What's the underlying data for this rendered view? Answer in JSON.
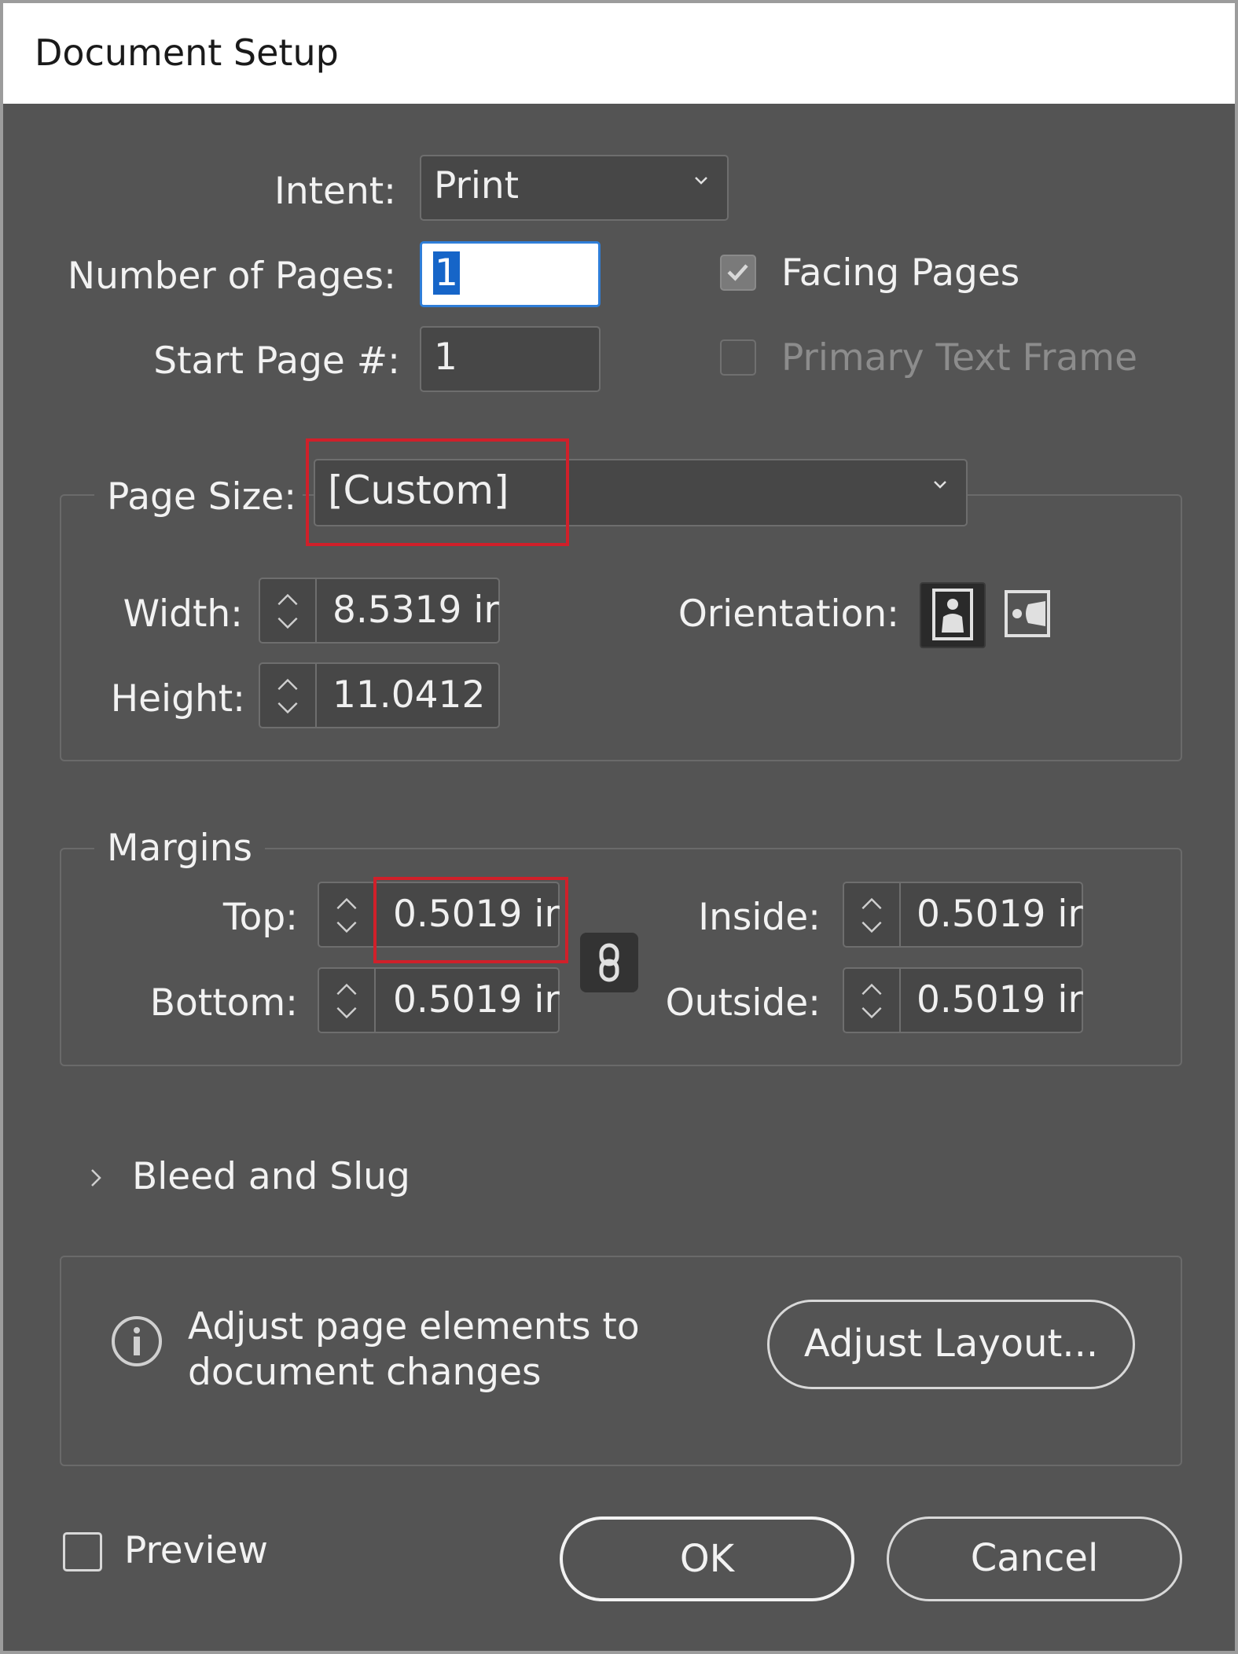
{
  "window": {
    "title": "Document Setup"
  },
  "intent": {
    "label": "Intent:",
    "value": "Print"
  },
  "pages": {
    "number_label": "Number of Pages:",
    "number_value": "1",
    "start_label": "Start Page #:",
    "start_value": "1",
    "facing_pages_label": "Facing Pages",
    "facing_pages_checked": true,
    "primary_text_frame_label": "Primary Text Frame",
    "primary_text_frame_checked": false
  },
  "page_size": {
    "label": "Page Size:",
    "value": "[Custom]",
    "width_label": "Width:",
    "width_value": "8.5319 ir",
    "height_label": "Height:",
    "height_value": "11.0412",
    "orientation_label": "Orientation:",
    "orientation_options": [
      "portrait-icon",
      "landscape-icon"
    ],
    "orientation_selected": "portrait-icon"
  },
  "margins": {
    "legend": "Margins",
    "top_label": "Top:",
    "top_value": "0.5019 ir",
    "bottom_label": "Bottom:",
    "bottom_value": "0.5019 ir",
    "inside_label": "Inside:",
    "inside_value": "0.5019 ir",
    "outside_label": "Outside:",
    "outside_value": "0.5019 ir",
    "link_icon": "chain-link-icon"
  },
  "bleed": {
    "label": "Bleed and Slug",
    "expanded": false
  },
  "adjust": {
    "text_line1": "Adjust page elements to",
    "text_line2": "document changes",
    "button_label": "Adjust Layout...",
    "icon": "info-icon"
  },
  "footer": {
    "preview_label": "Preview",
    "preview_checked": false,
    "ok_label": "OK",
    "cancel_label": "Cancel"
  },
  "colors": {
    "dialog_bg": "#545454",
    "field_bg": "#474747",
    "highlight": "#d0202a",
    "selection": "#1665c8"
  }
}
